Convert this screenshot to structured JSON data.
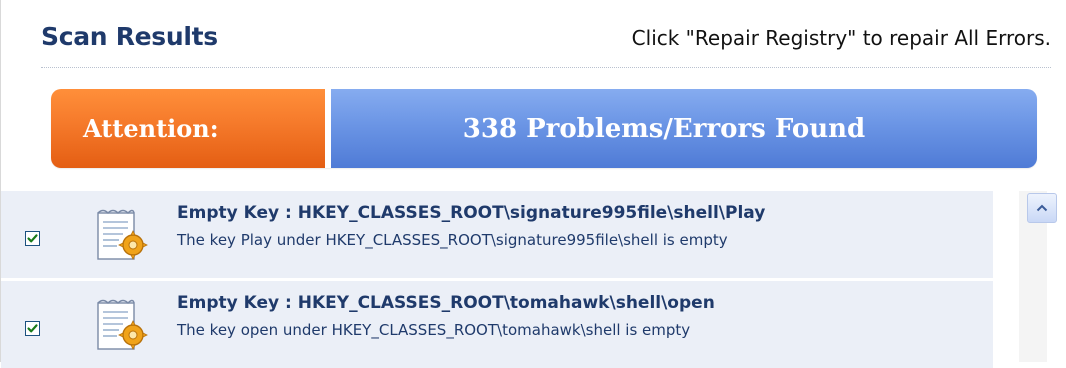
{
  "header": {
    "title": "Scan Results",
    "instruction": "Click \"Repair Registry\" to repair All Errors."
  },
  "banner": {
    "attention_label": "Attention:",
    "summary": "338 Problems/Errors Found"
  },
  "results": [
    {
      "checked": true,
      "icon": "registry-fix-icon",
      "title": "Empty Key : HKEY_CLASSES_ROOT\\signature995file\\shell\\Play",
      "description": "The key Play under HKEY_CLASSES_ROOT\\signature995file\\shell is empty"
    },
    {
      "checked": true,
      "icon": "registry-fix-icon",
      "title": "Empty Key : HKEY_CLASSES_ROOT\\tomahawk\\shell\\open",
      "description": "The key open under HKEY_CLASSES_ROOT\\tomahawk\\shell is empty"
    }
  ],
  "colors": {
    "title": "#1f3a6b",
    "attention": "#f5792a",
    "summary": "#6b95e5",
    "row_bg": "#ebeff7"
  }
}
